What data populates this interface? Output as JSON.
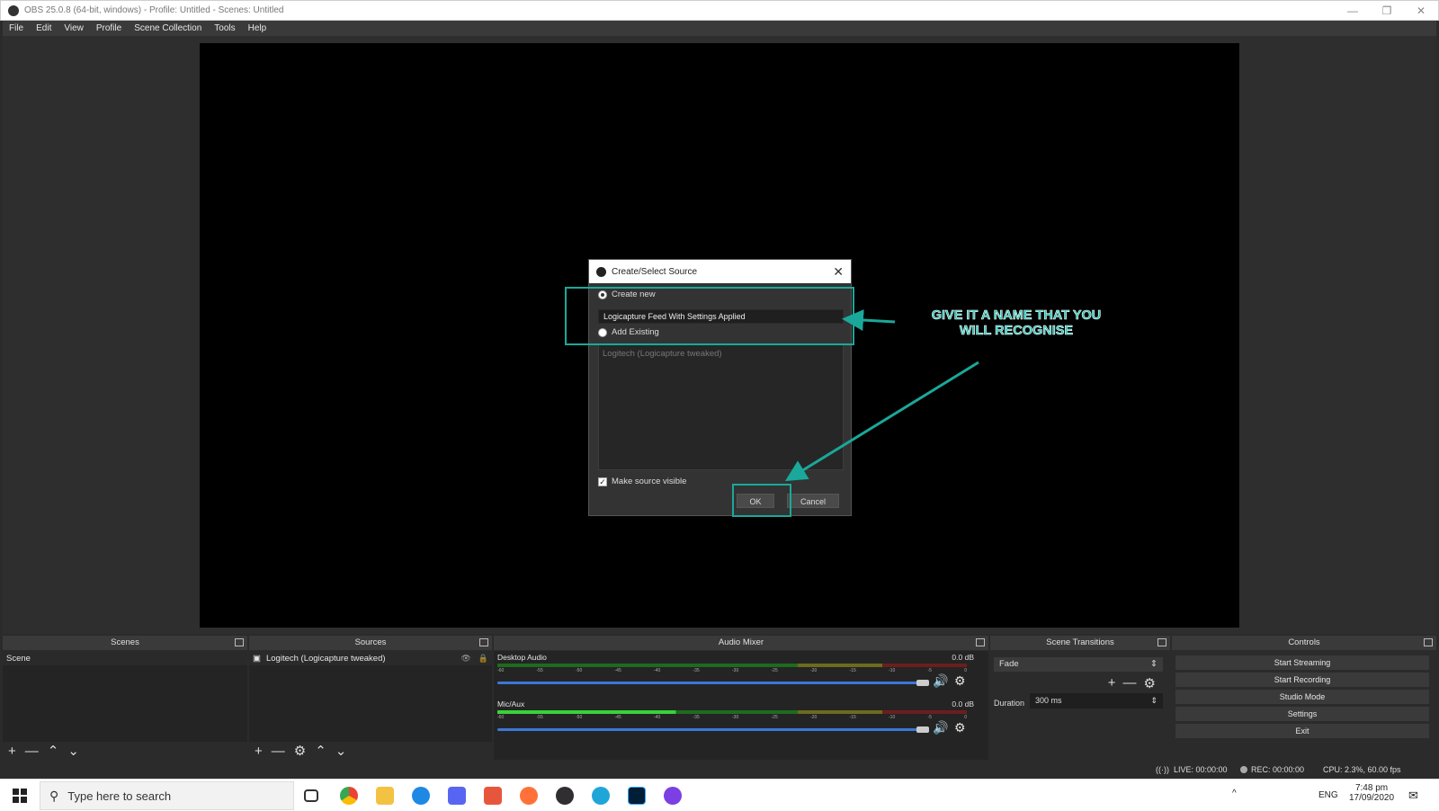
{
  "window": {
    "title": "OBS 25.0.8 (64-bit, windows) - Profile: Untitled - Scenes: Untitled",
    "minimize": "—",
    "restore": "❐",
    "close": "✕"
  },
  "menu": [
    "File",
    "Edit",
    "View",
    "Profile",
    "Scene Collection",
    "Tools",
    "Help"
  ],
  "dialog": {
    "title": "Create/Select Source",
    "close": "✕",
    "create_new_label": "Create new",
    "name_value": "Logicapture Feed With Settings Applied",
    "add_existing_label": "Add Existing",
    "existing_item": "Logitech (Logicapture tweaked)",
    "make_visible_label": "Make source visible",
    "make_visible_checked": true,
    "ok_label": "OK",
    "cancel_label": "Cancel"
  },
  "annotation": {
    "line1": "GIVE IT A NAME THAT YOU",
    "line2": "WILL RECOGNISE",
    "color": "#1aa89a"
  },
  "scenes": {
    "header": "Scenes",
    "items": [
      "Scene"
    ]
  },
  "sources": {
    "header": "Sources",
    "items": [
      "Logitech (Logicapture tweaked)"
    ]
  },
  "mixer": {
    "header": "Audio Mixer",
    "tracks": [
      {
        "name": "Desktop Audio",
        "db": "0.0 dB"
      },
      {
        "name": "Mic/Aux",
        "db": "0.0 dB"
      }
    ],
    "ticks": [
      "-60",
      "-55",
      "-50",
      "-45",
      "-40",
      "-35",
      "-30",
      "-25",
      "-20",
      "-15",
      "-10",
      "-5",
      "0"
    ]
  },
  "transitions": {
    "header": "Scene Transitions",
    "selected": "Fade",
    "duration_label": "Duration",
    "duration_value": "300 ms"
  },
  "controls": {
    "header": "Controls",
    "buttons": [
      "Start Streaming",
      "Start Recording",
      "Studio Mode",
      "Settings",
      "Exit"
    ]
  },
  "status": {
    "live": "LIVE: 00:00:00",
    "rec": "REC: 00:00:00",
    "cpu": "CPU: 2.3%, 60.00 fps"
  },
  "taskbar": {
    "search_placeholder": "Type here to search",
    "lang": "ENG",
    "time": "7:48 pm",
    "date": "17/09/2020"
  },
  "glyphs": {
    "plus": "+",
    "minus": "—",
    "up": "⌃",
    "down": "⌄",
    "gear": "⚙",
    "speaker": "🔊",
    "eye": "👁",
    "lock": "🔒",
    "camera": "▣",
    "check": "✓",
    "search": "⚲",
    "spin": "⇕",
    "chevron_up": "^",
    "bell": "✉"
  }
}
